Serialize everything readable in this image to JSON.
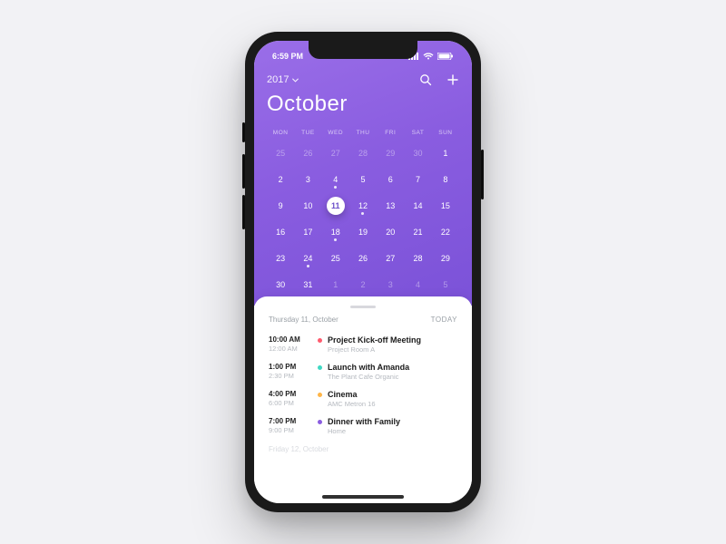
{
  "status": {
    "time": "6:59 PM"
  },
  "header": {
    "year": "2017",
    "month": "October"
  },
  "weekdays": [
    "MON",
    "TUE",
    "WED",
    "THU",
    "FRI",
    "SAT",
    "SUN"
  ],
  "calendar": {
    "selected_day": 11,
    "cells": [
      {
        "n": 25,
        "dim": true
      },
      {
        "n": 26,
        "dim": true
      },
      {
        "n": 27,
        "dim": true
      },
      {
        "n": 28,
        "dim": true
      },
      {
        "n": 29,
        "dim": true
      },
      {
        "n": 30,
        "dim": true
      },
      {
        "n": 1
      },
      {
        "n": 2
      },
      {
        "n": 3
      },
      {
        "n": 4,
        "dot": true
      },
      {
        "n": 5
      },
      {
        "n": 6
      },
      {
        "n": 7
      },
      {
        "n": 8
      },
      {
        "n": 9
      },
      {
        "n": 10
      },
      {
        "n": 11,
        "dot": true
      },
      {
        "n": 12,
        "dot": true
      },
      {
        "n": 13
      },
      {
        "n": 14
      },
      {
        "n": 15
      },
      {
        "n": 16
      },
      {
        "n": 17
      },
      {
        "n": 18,
        "dot": true
      },
      {
        "n": 19
      },
      {
        "n": 20
      },
      {
        "n": 21
      },
      {
        "n": 22
      },
      {
        "n": 23
      },
      {
        "n": 24,
        "dot": true
      },
      {
        "n": 25
      },
      {
        "n": 26
      },
      {
        "n": 27
      },
      {
        "n": 28
      },
      {
        "n": 29
      },
      {
        "n": 30
      },
      {
        "n": 31
      },
      {
        "n": 1,
        "dim": true
      },
      {
        "n": 2,
        "dim": true
      },
      {
        "n": 3,
        "dim": true
      },
      {
        "n": 4,
        "dim": true
      },
      {
        "n": 5,
        "dim": true
      }
    ]
  },
  "agenda": {
    "header_date": "Thursday 11, October",
    "today_label": "TODAY",
    "events": [
      {
        "start": "10:00 AM",
        "end": "12:00 AM",
        "title": "Project Kick-off Meeting",
        "sub": "Project Room A",
        "color": "#ff5b6e"
      },
      {
        "start": "1:00 PM",
        "end": "2:30 PM",
        "title": "Launch with Amanda",
        "sub": "The Plant Cafe Organic",
        "color": "#3fd8c3"
      },
      {
        "start": "4:00 PM",
        "end": "6:00 PM",
        "title": "Cinema",
        "sub": "AMC Metron 16",
        "color": "#ffb547"
      },
      {
        "start": "7:00 PM",
        "end": "9:00 PM",
        "title": "Dinner with Family",
        "sub": "Home",
        "color": "#8a5de0"
      }
    ],
    "next_header": "Friday 12, October"
  }
}
